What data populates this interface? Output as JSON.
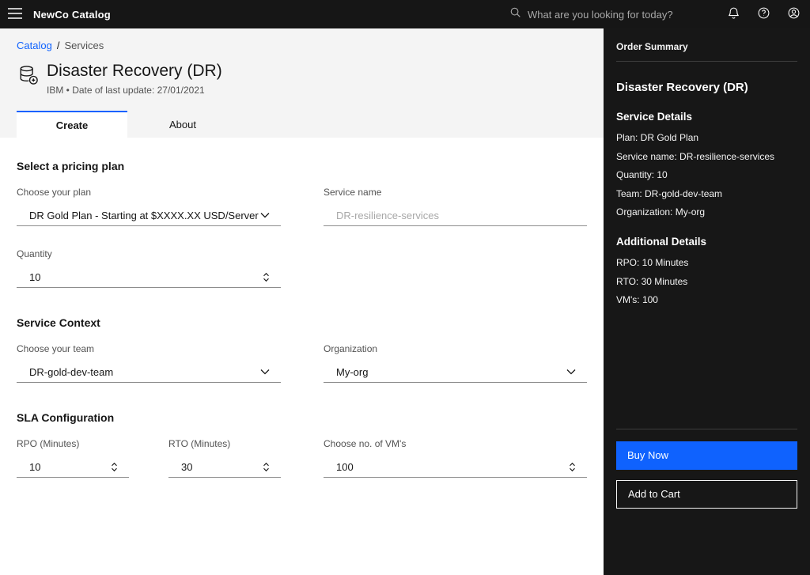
{
  "header": {
    "title": "NewCo Catalog",
    "search_placeholder": "What are you looking for today?"
  },
  "breadcrumb": {
    "items": [
      "Catalog",
      "Services"
    ],
    "separator": "/"
  },
  "page": {
    "title": "Disaster Recovery (DR)",
    "subtitle": "IBM • Date of last update: 27/01/2021"
  },
  "tabs": [
    {
      "label": "Create"
    },
    {
      "label": "About"
    }
  ],
  "form": {
    "pricing": {
      "heading": "Select a pricing plan",
      "plan_label": "Choose your plan",
      "plan_value": "DR Gold Plan - Starting at $XXXX.XX USD/Server",
      "service_name_label": "Service name",
      "service_name_placeholder": "DR-resilience-services",
      "quantity_label": "Quantity",
      "quantity_value": "10"
    },
    "context": {
      "heading": "Service Context",
      "team_label": "Choose your team",
      "team_value": "DR-gold-dev-team",
      "org_label": "Organization",
      "org_value": "My-org"
    },
    "sla": {
      "heading": "SLA Configuration",
      "rpo_label": "RPO (Minutes)",
      "rpo_value": "10",
      "rto_label": "RTO (Minutes)",
      "rto_value": "30",
      "vm_label": "Choose no. of VM's",
      "vm_value": "100"
    }
  },
  "summary": {
    "heading": "Order Summary",
    "product": "Disaster Recovery (DR)",
    "service_details_heading": "Service Details",
    "service_details": [
      "Plan: DR Gold Plan",
      "Service name: DR-resilience-services",
      "Quantity: 10",
      "Team: DR-gold-dev-team",
      "Organization: My-org"
    ],
    "additional_heading": "Additional Details",
    "additional_details": [
      "RPO: 10 Minutes",
      "RTO: 30 Minutes",
      "VM's: 100"
    ],
    "buy_now_label": "Buy Now",
    "add_to_cart_label": "Add to Cart"
  },
  "colors": {
    "accent": "#0f62fe",
    "header_bg": "#161616",
    "sidebar_bg": "#171717"
  }
}
